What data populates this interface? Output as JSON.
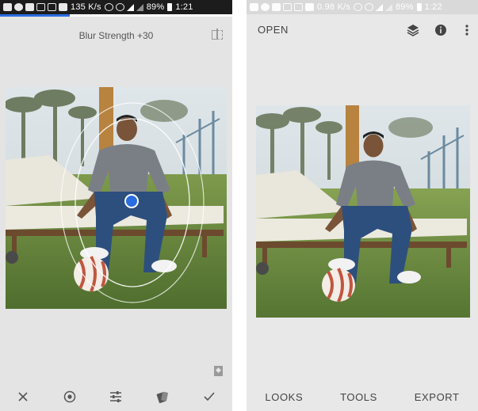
{
  "left_screen": {
    "status_bar": {
      "speed": "135 K/s",
      "battery": "89%",
      "time": "1:21"
    },
    "editing_progress_percent": 30,
    "title": "Blur Strength +30",
    "bottom_tools": [
      {
        "name": "cancel",
        "icon": "close-icon"
      },
      {
        "name": "focus-shape",
        "icon": "circle-target-icon"
      },
      {
        "name": "adjust",
        "icon": "sliders-icon"
      },
      {
        "name": "styles",
        "icon": "style-swatch-icon"
      },
      {
        "name": "apply",
        "icon": "checkmark-icon"
      }
    ]
  },
  "right_screen": {
    "status_bar": {
      "speed": "0.98 K/s",
      "battery": "89%",
      "time": "1:22"
    },
    "open_label": "OPEN",
    "top_icons": [
      "layers-icon",
      "info-icon",
      "more-vert-icon"
    ],
    "nav": {
      "looks": "LOOKS",
      "tools": "TOOLS",
      "export": "EXPORT"
    }
  },
  "colors": {
    "accent_blue": "#2a6de0",
    "panel_bg": "#e4e4e4"
  }
}
